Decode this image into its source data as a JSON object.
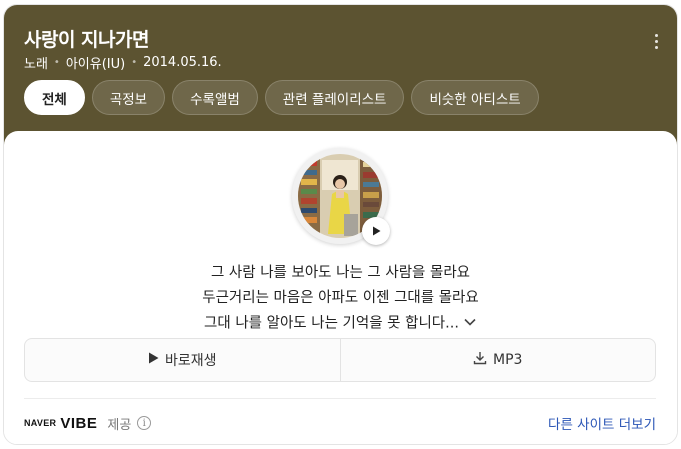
{
  "song": {
    "title": "사랑이 지나가면",
    "type": "노래",
    "artist": "아이유(IU)",
    "date": "2014.05.16."
  },
  "tabs": [
    {
      "label": "전체",
      "active": true
    },
    {
      "label": "곡정보",
      "active": false
    },
    {
      "label": "수록앨범",
      "active": false
    },
    {
      "label": "관련 플레이리스트",
      "active": false
    },
    {
      "label": "비슷한 아티스트",
      "active": false
    }
  ],
  "lyrics": {
    "line1": "그 사람 나를 보아도 나는 그 사람을 몰라요",
    "line2": "두근거리는 마음은 아파도 이젠 그대를 몰라요",
    "line3": "그대 나를 알아도 나는 기억을 못 합니다..."
  },
  "actions": {
    "play_label": "바로재생",
    "mp3_label": "MP3"
  },
  "footer": {
    "brand_naver": "NAVER",
    "brand_vibe": "VIBE",
    "provided_by": "제공",
    "info_symbol": "i",
    "more_sites": "다른 사이트 더보기"
  },
  "colors": {
    "header_bg": "#5c5331",
    "link": "#2b56b6"
  },
  "icons": {
    "more": "more-vertical-icon",
    "play": "play-icon",
    "download": "download-icon",
    "expand": "chevron-down-icon",
    "info": "info-icon"
  }
}
